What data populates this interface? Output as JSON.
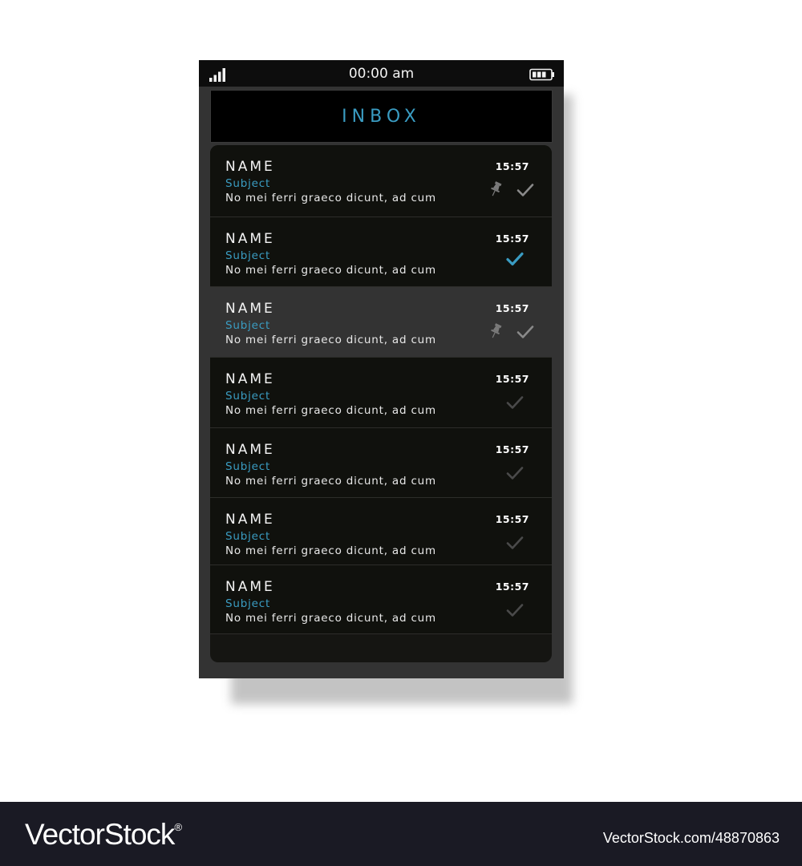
{
  "status_bar": {
    "time": "00:00 am",
    "signal_icon": "signal-bars-icon",
    "battery_icon": "battery-icon"
  },
  "inbox": {
    "title": "INBOX"
  },
  "messages": [
    {
      "name": "NAME",
      "subject": "Subject",
      "preview": "No mei ferri graeco dicunt, ad cum",
      "time": "15:57",
      "pinned": true,
      "check": "read",
      "highlighted": false
    },
    {
      "name": "NAME",
      "subject": "Subject",
      "preview": "No mei ferri graeco dicunt, ad cum",
      "time": "15:57",
      "pinned": false,
      "check": "active",
      "highlighted": false
    },
    {
      "name": "NAME",
      "subject": "Subject",
      "preview": "No mei ferri graeco dicunt, ad cum",
      "time": "15:57",
      "pinned": true,
      "check": "read",
      "highlighted": true
    },
    {
      "name": "NAME",
      "subject": "Subject",
      "preview": "No mei ferri graeco dicunt, ad cum",
      "time": "15:57",
      "pinned": false,
      "check": "dim",
      "highlighted": false
    },
    {
      "name": "NAME",
      "subject": "Subject",
      "preview": "No mei ferri graeco dicunt, ad cum",
      "time": "15:57",
      "pinned": false,
      "check": "dim",
      "highlighted": false
    },
    {
      "name": "NAME",
      "subject": "Subject",
      "preview": "No mei ferri graeco dicunt, ad cum",
      "time": "15:57",
      "pinned": false,
      "check": "dim",
      "highlighted": false
    },
    {
      "name": "NAME",
      "subject": "Subject",
      "preview": "No mei ferri graeco dicunt, ad cum",
      "time": "15:57",
      "pinned": false,
      "check": "dim",
      "highlighted": false
    }
  ],
  "colors": {
    "accent": "#3a9cc2",
    "check_read": "#8a8a8a",
    "check_dim": "#4a4a4a",
    "pin": "#7a7a7a"
  },
  "footer": {
    "brand": "VectorStock",
    "registered": "®",
    "image_id": "VectorStock.com/48870863"
  }
}
